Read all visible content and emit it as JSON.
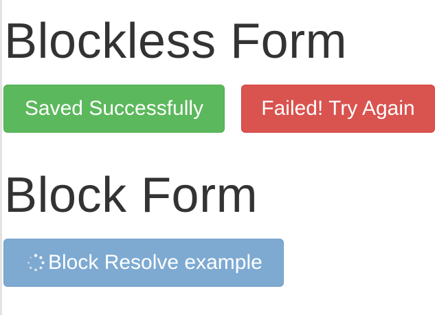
{
  "headings": {
    "blockless": "Blockless Form",
    "block": "Block Form"
  },
  "buttons": {
    "saved": "Saved Successfully",
    "failed": "Failed! Try Again",
    "block_resolve": "Block Resolve example"
  },
  "icons": {
    "spinner": "loading-spinner-icon"
  },
  "colors": {
    "success": "#5cb85c",
    "danger": "#d9534f",
    "primary_disabled": "#7eaad2",
    "text": "#333333"
  }
}
